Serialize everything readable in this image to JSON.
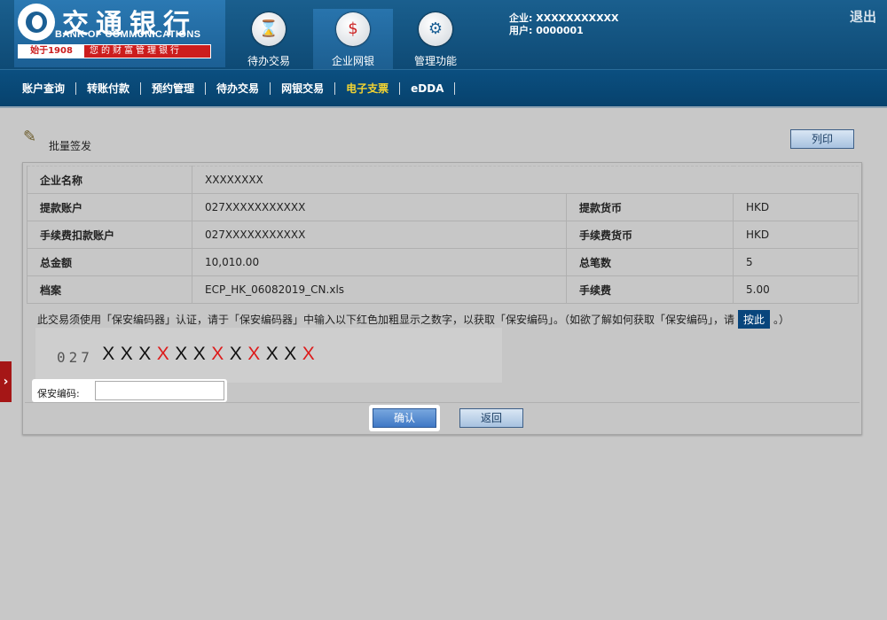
{
  "logo": {
    "name_cn": "交通银行",
    "name_en": "BANK OF COMMUNICATIONS",
    "since": "始于1908",
    "slogan": "您的财富管理银行"
  },
  "topnav": [
    {
      "label": "待办交易",
      "icon": "hourglass-icon"
    },
    {
      "label": "企业网银",
      "icon": "monitor-dollar-icon"
    },
    {
      "label": "管理功能",
      "icon": "gears-icon"
    }
  ],
  "user": {
    "company": "企业: XXXXXXXXXXX",
    "user": "用户: 0000001"
  },
  "logout": "退出",
  "subnav": [
    "账户查询",
    "转账付款",
    "预约管理",
    "待办交易",
    "网银交易",
    "电子支票",
    "eDDA"
  ],
  "subnav_active": "电子支票",
  "section_title": "批量签发",
  "print_label": "列印",
  "info": {
    "company_label": "企业名称",
    "company_value": "XXXXXXXX",
    "account_label": "提款账户",
    "account_value": "027XXXXXXXXXXX",
    "currency_label": "提款货币",
    "currency_value": "HKD",
    "fee_account_label": "手续费扣款账户",
    "fee_account_value": "027XXXXXXXXXXX",
    "fee_currency_label": "手续费货币",
    "fee_currency_value": "HKD",
    "total_label": "总金额",
    "total_value": "10,010.00",
    "count_label": "总笔数",
    "count_value": "5",
    "file_label": "档案",
    "file_value": "ECP_HK_06082019_CN.xls",
    "fee_label": "手续费",
    "fee_value": "5.00"
  },
  "notice": {
    "text_before": "此交易须使用「保安编码器」认证，请于「保安编码器」中输入以下红色加粗显示之数字，以获取「保安编码」。（如欲了解如何获取「保安编码」，请",
    "here": "按此",
    "text_after": "。）"
  },
  "code": {
    "prefix": "027",
    "chars": [
      "X",
      "X",
      "X",
      "X",
      "X",
      "X",
      "X",
      "X",
      "X",
      "X",
      "X",
      "X"
    ],
    "red": [
      false,
      false,
      false,
      true,
      false,
      false,
      true,
      false,
      true,
      false,
      false,
      true
    ]
  },
  "passcode_label": "保安编码:",
  "passcode_value": "",
  "confirm_label": "确认",
  "back_label": "返回",
  "side_toggle": "›",
  "colors": {
    "accent_red": "#dd1a1a",
    "nav_blue": "#0b4f80",
    "active_nav": "#f3d432"
  }
}
